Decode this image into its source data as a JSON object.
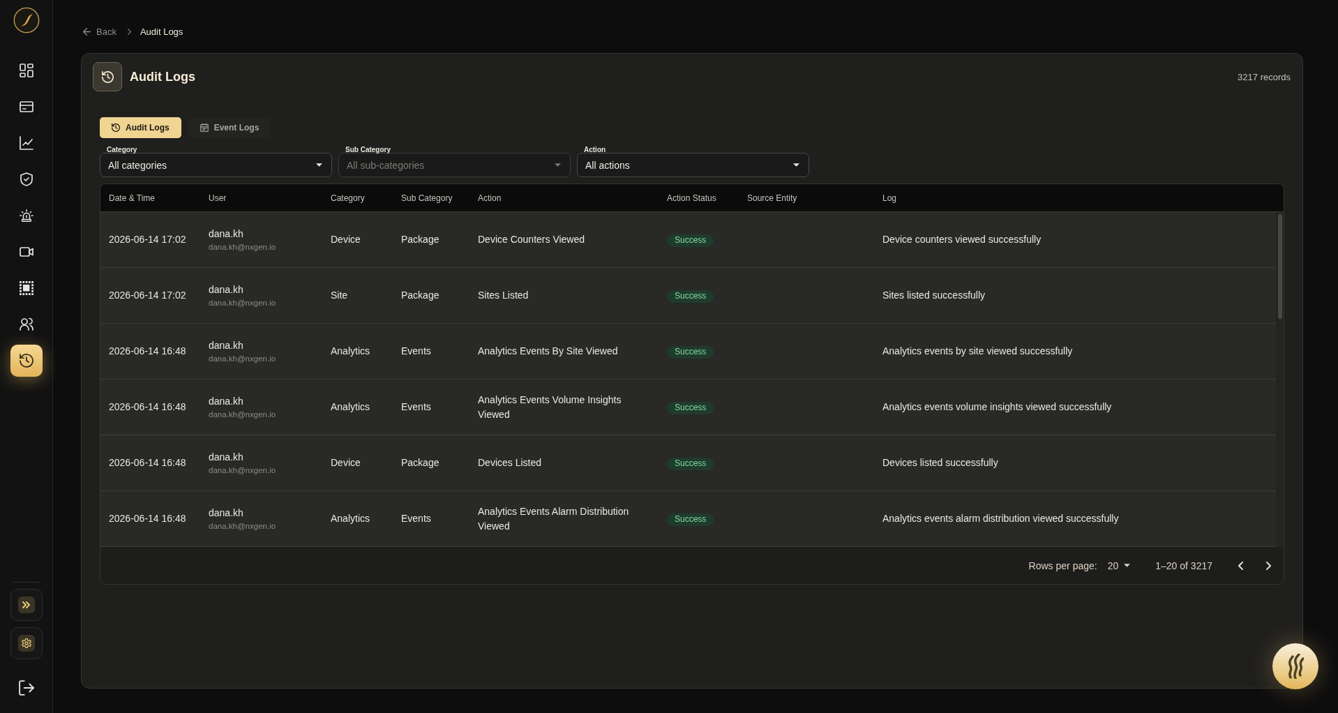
{
  "sidebar": {
    "nav_items": [
      {
        "selected": false
      },
      {
        "selected": false
      },
      {
        "selected": false
      },
      {
        "selected": false
      },
      {
        "selected": false
      },
      {
        "selected": false
      },
      {
        "selected": false
      },
      {
        "selected": false
      },
      {
        "selected": true
      }
    ]
  },
  "breadcrumb": {
    "back": "Back",
    "current": "Audit Logs"
  },
  "page": {
    "title": "Audit Logs",
    "record_count": "3217 records"
  },
  "tabs": [
    {
      "label": "Audit Logs",
      "selected": true
    },
    {
      "label": "Event Logs",
      "selected": false
    }
  ],
  "filters": [
    {
      "label": "Category",
      "value": "All categories",
      "disabled": false
    },
    {
      "label": "Sub Category",
      "value": "All sub-categories",
      "disabled": true
    },
    {
      "label": "Action",
      "value": "All actions",
      "disabled": false
    }
  ],
  "table": {
    "columns": [
      "Date & Time",
      "User",
      "Category",
      "Sub Category",
      "Action",
      "Action Status",
      "Source Entity",
      "Log"
    ],
    "rows": [
      {
        "date_time": "2026-06-14 17:02",
        "user": "dana.kh",
        "email": "dana.kh@nxgen.io",
        "category": "Device",
        "sub_category": "Package",
        "action": "Device Counters Viewed",
        "action_status": "Success",
        "log": "Device counters viewed successfully"
      },
      {
        "date_time": "2026-06-14 17:02",
        "user": "dana.kh",
        "email": "dana.kh@nxgen.io",
        "category": "Site",
        "sub_category": "Package",
        "action": "Sites Listed",
        "action_status": "Success",
        "log": "Sites listed successfully"
      },
      {
        "date_time": "2026-06-14 16:48",
        "user": "dana.kh",
        "email": "dana.kh@nxgen.io",
        "category": "Analytics",
        "sub_category": "Events",
        "action": "Analytics Events By Site Viewed",
        "action_status": "Success",
        "log": "Analytics events by site viewed successfully"
      },
      {
        "date_time": "2026-06-14 16:48",
        "user": "dana.kh",
        "email": "dana.kh@nxgen.io",
        "category": "Analytics",
        "sub_category": "Events",
        "action": "Analytics Events Volume Insights Viewed",
        "action_status": "Success",
        "log": "Analytics events volume insights viewed successfully"
      },
      {
        "date_time": "2026-06-14 16:48",
        "user": "dana.kh",
        "email": "dana.kh@nxgen.io",
        "category": "Device",
        "sub_category": "Package",
        "action": "Devices Listed",
        "action_status": "Success",
        "log": "Devices listed successfully"
      },
      {
        "date_time": "2026-06-14 16:48",
        "user": "dana.kh",
        "email": "dana.kh@nxgen.io",
        "category": "Analytics",
        "sub_category": "Events",
        "action": "Analytics Events Alarm Distribution Viewed",
        "action_status": "Success",
        "log": "Analytics events alarm distribution viewed successfully"
      }
    ]
  },
  "pagination": {
    "rows_per_page_label": "Rows per page:",
    "rows_per_page": "20",
    "range": "1–20 of 3217"
  }
}
